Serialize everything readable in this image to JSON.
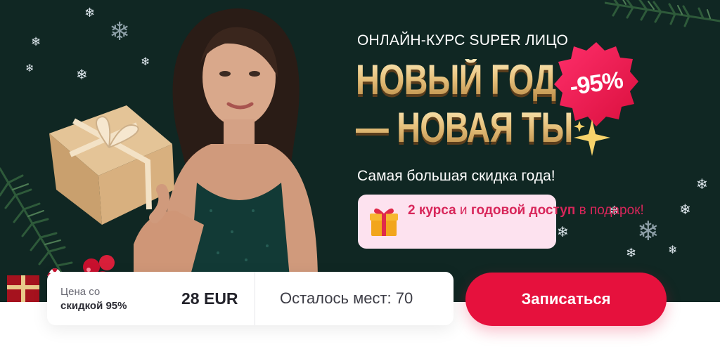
{
  "banner": {
    "eyebrow": "ОНЛАЙН-КУРС SUPER ЛИЦО",
    "headline_line1": "НОВЫЙ ГОД",
    "headline_line2": "— НОВАЯ ТЫ",
    "discount_badge": "-95%",
    "subtitle": "Самая большая скидка года!",
    "promo": {
      "icon": "gift-icon",
      "bold_1": "2 курса",
      "text_1": " и ",
      "bold_2": "годовой доступ",
      "text_2": " в подарок!"
    }
  },
  "offer": {
    "price_label_line1": "Цена со",
    "price_label_line2": "скидкой 95%",
    "price": "28 EUR",
    "seats": "Осталось мест: 70"
  },
  "cta": {
    "label": "Записаться"
  },
  "colors": {
    "background": "#102723",
    "accent": "#e6113d",
    "promo_bg": "#fde2ef",
    "promo_text": "#d8265a",
    "gold": "#e8c37e"
  }
}
